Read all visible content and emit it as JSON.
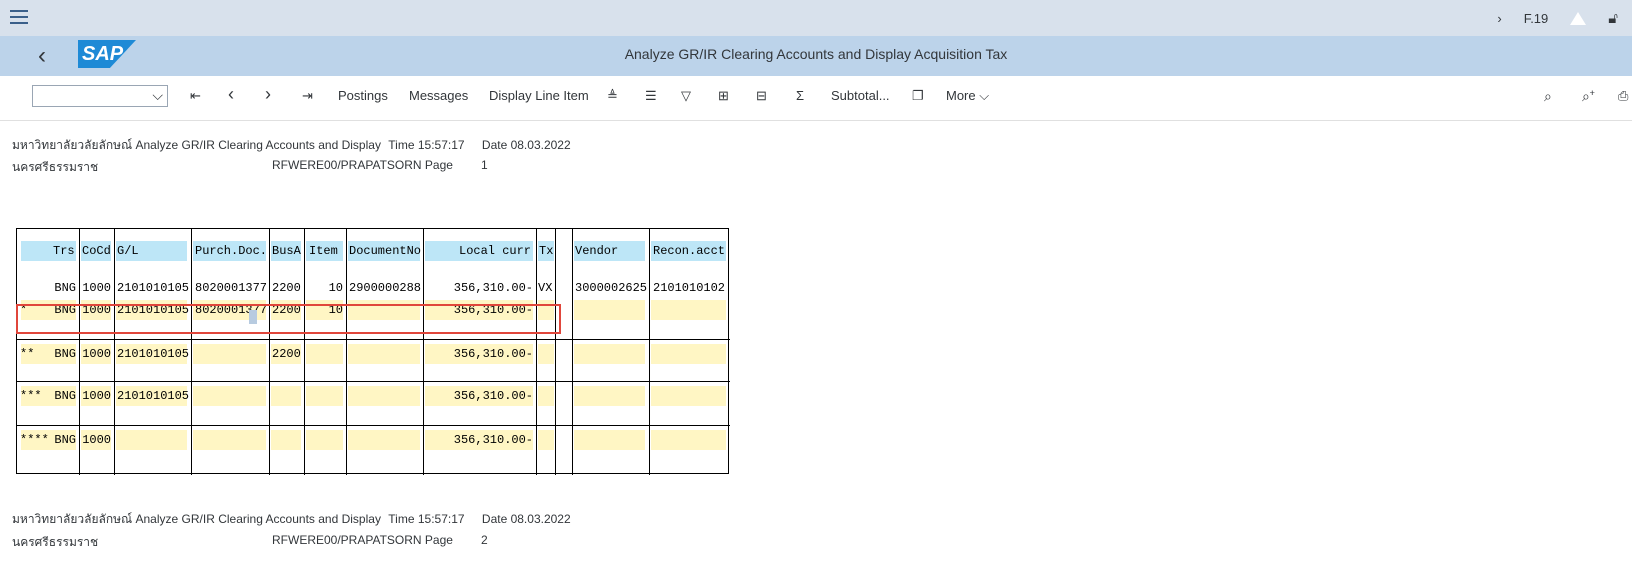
{
  "topbar": {
    "transaction": "F.19"
  },
  "titlebar": {
    "title": "Analyze GR/IR Clearing Accounts and Display Acquisition Tax",
    "logo": "SAP"
  },
  "toolbar": {
    "select_value": "",
    "postings": "Postings",
    "messages": "Messages",
    "display_line_item": "Display Line Item",
    "subtotal": "Subtotal...",
    "more": "More",
    "first": "⇤",
    "prev": "‹",
    "next": "›",
    "last": "⇥",
    "sigma": "Σ"
  },
  "report1": {
    "org": "มหาวิทยาลัยวลัยลักษณ์",
    "title": "Analyze GR/IR Clearing Accounts and Display",
    "time": "Time 15:57:17",
    "date": "Date  08.03.2022",
    "city": "นครศรีธรรมราช",
    "program": "RFWERE00/PRAPATSORN Page",
    "page": "1"
  },
  "report2": {
    "org": "มหาวิทยาลัยวลัยลักษณ์",
    "title": "Analyze GR/IR Clearing Accounts and Display",
    "time": "Time 15:57:17",
    "date": "Date  08.03.2022",
    "city": "นครศรีธรรมราช",
    "program": "RFWERE00/PRAPATSORN Page",
    "page": "2"
  },
  "table": {
    "headers": [
      "Trs",
      "CoCd",
      "G/L",
      "Purch.Doc.",
      "BusA",
      "Item",
      "DocumentNo",
      "Local curr",
      "Tx",
      "Vendor",
      "Recon.acct"
    ],
    "rows": [
      [
        "",
        "BNG",
        "1000",
        "2101010105",
        "8020001377",
        "2200",
        "10",
        "2900000288",
        "356,310.00-",
        "VX",
        "3000002625",
        "2101010102"
      ],
      [
        "*",
        "BNG",
        "1000",
        "2101010105",
        "8020001377",
        "2200",
        "10",
        "",
        "356,310.00-",
        "",
        "",
        ""
      ],
      [
        "**",
        "BNG",
        "1000",
        "2101010105",
        "",
        "2200",
        "",
        "",
        "356,310.00-",
        "",
        "",
        ""
      ],
      [
        "***",
        "BNG",
        "1000",
        "2101010105",
        "",
        "",
        "",
        "",
        "356,310.00-",
        "",
        "",
        ""
      ],
      [
        "****",
        "BNG",
        "1000",
        "",
        "",
        "",
        "",
        "",
        "356,310.00-",
        "",
        "",
        ""
      ]
    ]
  }
}
